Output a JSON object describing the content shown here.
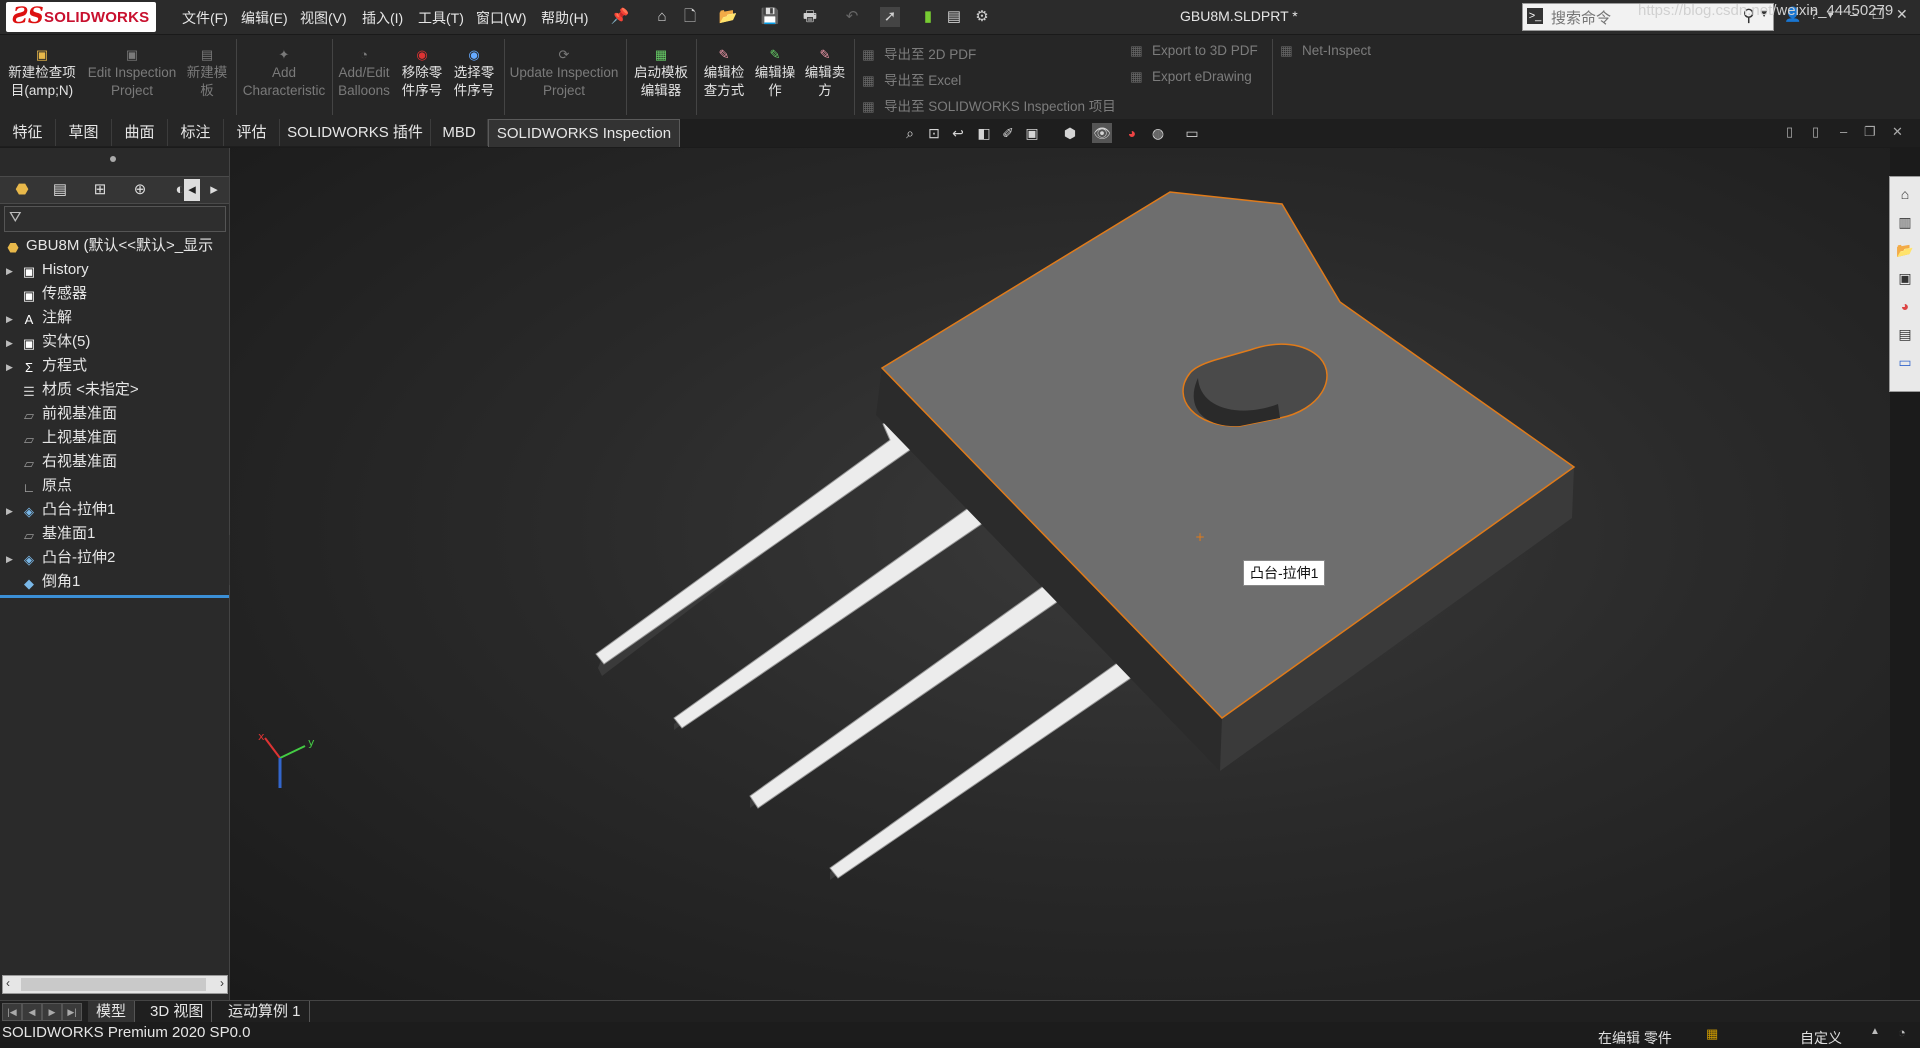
{
  "app": {
    "logo_text": "SOLIDWORKS",
    "document_title": "GBU8M.SLDPRT *"
  },
  "menu": [
    "文件(F)",
    "编辑(E)",
    "视图(V)",
    "插入(I)",
    "工具(T)",
    "窗口(W)",
    "帮助(H)"
  ],
  "search": {
    "placeholder": "搜索命令"
  },
  "command_manager": {
    "buttons": [
      {
        "label": "新建检查项目(amp;N)",
        "enabled": true
      },
      {
        "label": "Edit Inspection Project",
        "enabled": false
      },
      {
        "label": "新建模板",
        "enabled": false
      },
      {
        "label": "Add Characteristic",
        "enabled": false
      },
      {
        "label": "Add/Edit Balloons",
        "enabled": false
      },
      {
        "label": "移除零件序号",
        "enabled": true
      },
      {
        "label": "选择零件序号",
        "enabled": true
      },
      {
        "label": "Update Inspection Project",
        "enabled": false
      },
      {
        "label": "启动模板编辑器",
        "enabled": true
      },
      {
        "label": "编辑检查方式",
        "enabled": true
      },
      {
        "label": "编辑操作",
        "enabled": true
      },
      {
        "label": "编辑卖方",
        "enabled": true
      }
    ],
    "export_items": [
      "导出至 2D PDF",
      "导出至 Excel",
      "导出至 SOLIDWORKS Inspection 项目"
    ],
    "export_items_right": [
      "Export to 3D PDF",
      "Export eDrawing"
    ],
    "net_inspect": "Net-Inspect"
  },
  "tabs": [
    {
      "label": "特征",
      "active": false
    },
    {
      "label": "草图",
      "active": false
    },
    {
      "label": "曲面",
      "active": false
    },
    {
      "label": "标注",
      "active": false
    },
    {
      "label": "评估",
      "active": false
    },
    {
      "label": "SOLIDWORKS 插件",
      "active": false
    },
    {
      "label": "MBD",
      "active": false
    },
    {
      "label": "SOLIDWORKS Inspection",
      "active": true
    }
  ],
  "feature_tree": {
    "root": "GBU8M  (默认<<默认>_显示",
    "items": [
      {
        "label": "History",
        "expandable": true,
        "icon": "history-folder-icon"
      },
      {
        "label": "传感器",
        "expandable": false,
        "icon": "sensor-folder-icon"
      },
      {
        "label": "注解",
        "expandable": true,
        "icon": "annotation-folder-icon"
      },
      {
        "label": "实体(5)",
        "expandable": true,
        "icon": "solid-bodies-icon"
      },
      {
        "label": "方程式",
        "expandable": true,
        "icon": "equations-icon"
      },
      {
        "label": "材质 <未指定>",
        "expandable": false,
        "icon": "material-icon"
      },
      {
        "label": "前视基准面",
        "expandable": false,
        "icon": "plane-icon"
      },
      {
        "label": "上视基准面",
        "expandable": false,
        "icon": "plane-icon"
      },
      {
        "label": "右视基准面",
        "expandable": false,
        "icon": "plane-icon"
      },
      {
        "label": "原点",
        "expandable": false,
        "icon": "origin-icon"
      },
      {
        "label": "凸台-拉伸1",
        "expandable": true,
        "icon": "extrude-icon"
      },
      {
        "label": "基准面1",
        "expandable": false,
        "icon": "plane-icon"
      },
      {
        "label": "凸台-拉伸2",
        "expandable": true,
        "icon": "extrude-icon"
      },
      {
        "label": "倒角1",
        "expandable": false,
        "icon": "chamfer-icon"
      }
    ]
  },
  "viewport": {
    "tooltip": "凸台-拉伸1"
  },
  "bottom_tabs": [
    {
      "label": "模型",
      "active": true
    },
    {
      "label": "3D 视图",
      "active": false
    },
    {
      "label": "运动算例 1",
      "active": false
    }
  ],
  "status": {
    "product": "SOLIDWORKS Premium 2020 SP0.0",
    "watermark_url": "https://blog.csdn.net/weixin_44450279",
    "editing": "在编辑 零件",
    "custom": "自定义"
  },
  "colors": {
    "accent_blue": "#3b8fd6",
    "selection_orange": "#e07b1a",
    "brand_red": "#c8102e"
  }
}
